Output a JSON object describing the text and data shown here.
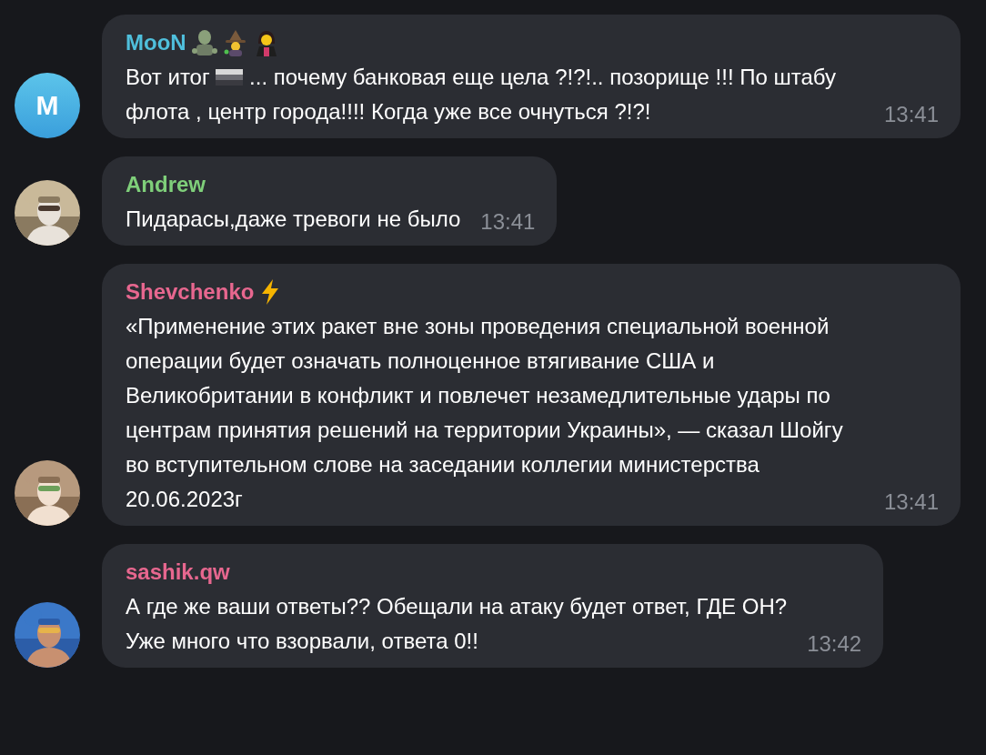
{
  "messages": [
    {
      "sender": "MooN",
      "color": "#4fbfdc",
      "name_icons": [
        {
          "kind": "zombie"
        },
        {
          "kind": "mage"
        },
        {
          "kind": "vampire"
        }
      ],
      "avatar": {
        "kind": "letter",
        "text": "M"
      },
      "body": [
        {
          "kind": "text",
          "text": "Вот итог "
        },
        {
          "kind": "flag"
        },
        {
          "kind": "text",
          "text": " ... почему банковая еще цела ?!?!.. позорище !!! По штабу флота , центр города!!!! Когда уже все очнуться ?!?!"
        }
      ],
      "time": "13:41"
    },
    {
      "sender": "Andrew",
      "color": "#7fcf7a",
      "body": [
        {
          "kind": "text",
          "text": "Пидарасы,даже тревоги не было"
        }
      ],
      "time": "13:41"
    },
    {
      "sender": "Shevchenko",
      "color": "#e7678f",
      "name_icons": [
        {
          "kind": "bolt"
        }
      ],
      "body": [
        {
          "kind": "text",
          "text": "«Применение этих ракет вне зоны проведения специальной военной операции будет означать полноценное втягивание США и Великобритании в конфликт и повлечет незамедлительные удары по центрам принятия решений на территории Украины», — сказал Шойгу во вступительном слове на заседании коллегии министерства\n20.06.2023г"
        }
      ],
      "time": "13:41"
    },
    {
      "sender": "sashik.qw",
      "color": "#e7678f",
      "body": [
        {
          "kind": "text",
          "text": "А где же ваши ответы?? Обещали на атаку будет ответ, ГДЕ ОН?\nУже много что взорвали, ответа 0!!"
        }
      ],
      "time": "13:42"
    }
  ]
}
